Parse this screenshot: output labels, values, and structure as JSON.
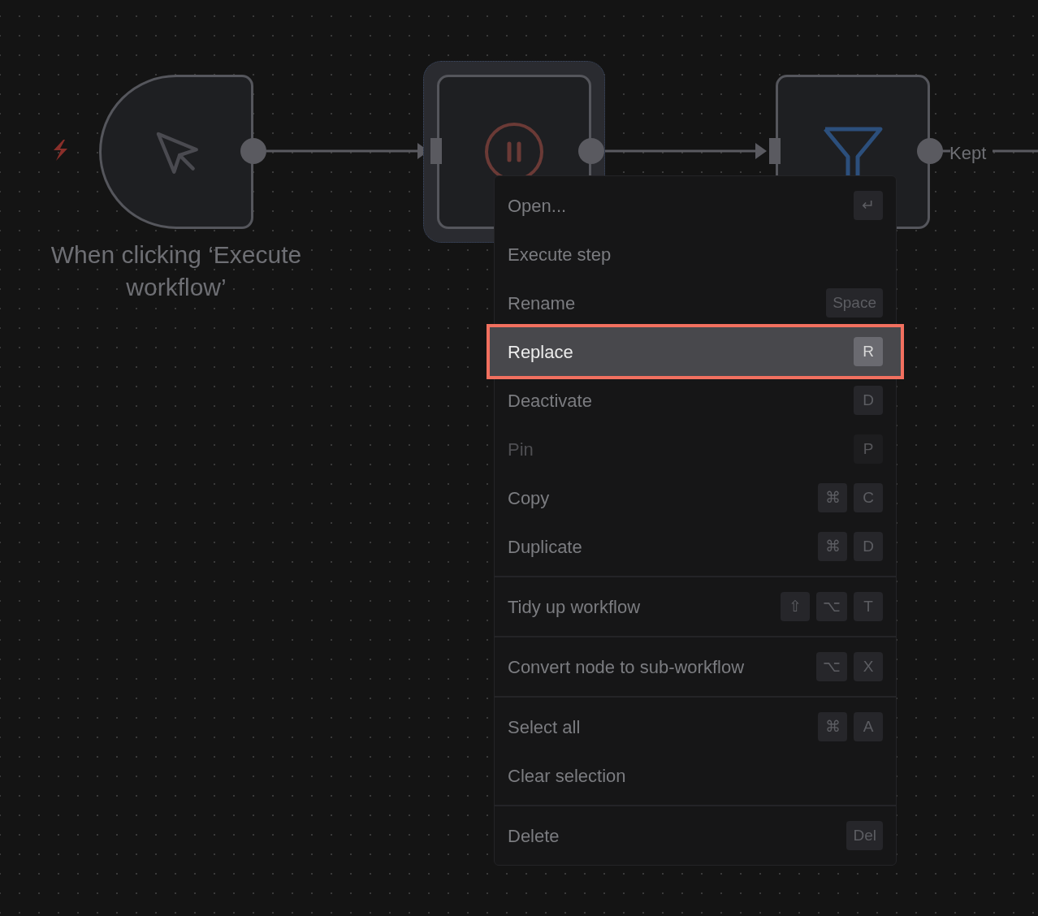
{
  "nodes": [
    {
      "kind": "trigger",
      "label": "When clicking ‘Execute workflow’",
      "selected": false
    },
    {
      "kind": "wait",
      "selected": true
    },
    {
      "kind": "filter",
      "selected": false
    }
  ],
  "edge_label": "Kept",
  "context_menu": {
    "groups": [
      {
        "items": [
          {
            "label": "Open...",
            "keys": [
              "↵"
            ],
            "highlighted": false,
            "disabled": false
          },
          {
            "label": "Execute step",
            "highlighted": false,
            "disabled": false
          },
          {
            "label": "Rename",
            "keys": [
              "Space"
            ],
            "highlighted": false,
            "disabled": false
          },
          {
            "label": "Replace",
            "keys": [
              "R"
            ],
            "highlighted": true,
            "disabled": false
          },
          {
            "label": "Deactivate",
            "keys": [
              "D"
            ],
            "highlighted": false,
            "disabled": false
          },
          {
            "label": "Pin",
            "keys": [
              "P"
            ],
            "highlighted": false,
            "disabled": true
          },
          {
            "label": "Copy",
            "keys": [
              "⌘",
              "C"
            ],
            "highlighted": false,
            "disabled": false
          },
          {
            "label": "Duplicate",
            "keys": [
              "⌘",
              "D"
            ],
            "highlighted": false,
            "disabled": false
          }
        ]
      },
      {
        "items": [
          {
            "label": "Tidy up workflow",
            "keys": [
              "⇧",
              "⌥",
              "T"
            ],
            "highlighted": false,
            "disabled": false
          }
        ]
      },
      {
        "items": [
          {
            "label": "Convert node to sub-workflow",
            "keys": [
              "⌥",
              "X"
            ],
            "highlighted": false,
            "disabled": false
          }
        ]
      },
      {
        "items": [
          {
            "label": "Select all",
            "keys": [
              "⌘",
              "A"
            ],
            "highlighted": false,
            "disabled": false
          },
          {
            "label": "Clear selection",
            "highlighted": false,
            "disabled": false
          }
        ]
      },
      {
        "items": [
          {
            "label": "Delete",
            "keys": [
              "Del"
            ],
            "highlighted": false,
            "disabled": false
          }
        ]
      }
    ]
  }
}
